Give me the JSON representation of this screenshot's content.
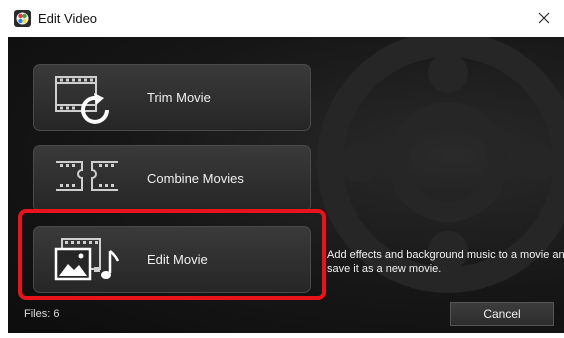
{
  "window": {
    "title": "Edit Video",
    "close_glyph": "✕"
  },
  "options": [
    {
      "label": "Trim Movie",
      "icon": "trim-movie-icon"
    },
    {
      "label": "Combine Movies",
      "icon": "combine-movies-icon"
    },
    {
      "label": "Edit Movie",
      "icon": "edit-movie-icon",
      "selected": true
    }
  ],
  "description": {
    "line1": "Add effects and background music to a movie and",
    "line2": "save it as a new movie."
  },
  "footer": {
    "files": "Files: 6",
    "cancel_label": "Cancel"
  },
  "colors": {
    "highlight": "#e8131b",
    "background": "#161616",
    "button": "#2e2e2e"
  }
}
